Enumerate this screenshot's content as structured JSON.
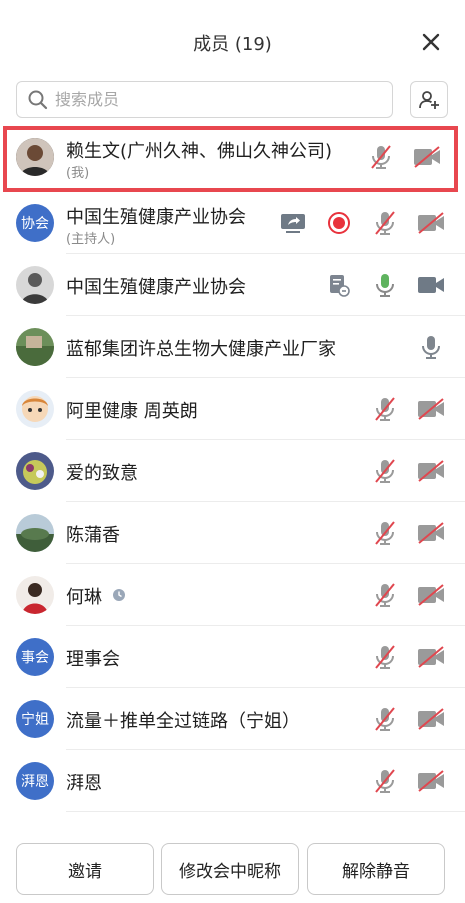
{
  "header": {
    "title": "成员 (19)"
  },
  "search": {
    "placeholder": "搜索成员"
  },
  "members": [
    {
      "name": "赖生文(广州久神、佛山久神公司)",
      "sub": "(我)",
      "avatar_text": "",
      "mic": "muted",
      "cam": "off"
    },
    {
      "name": "中国生殖健康产业协会",
      "sub": "(主持人)",
      "avatar_text": "协会",
      "mic": "muted",
      "cam": "off",
      "screen": true,
      "recording": true
    },
    {
      "name": "中国生殖健康产业协会",
      "sub": "",
      "avatar_text": "",
      "mic": "on",
      "cam": "on",
      "doc": true
    },
    {
      "name": "蓝郁集团许总生物大健康产业厂家",
      "sub": "",
      "avatar_text": "",
      "mic": "on-gray"
    },
    {
      "name": "阿里健康 周英朗",
      "sub": "",
      "avatar_text": "",
      "mic": "muted",
      "cam": "off"
    },
    {
      "name": "爱的致意",
      "sub": "",
      "avatar_text": "",
      "mic": "muted",
      "cam": "off"
    },
    {
      "name": "陈蒲香",
      "sub": "",
      "avatar_text": "",
      "mic": "muted",
      "cam": "off"
    },
    {
      "name": "何琳",
      "sub": "",
      "avatar_text": "",
      "mic": "muted",
      "cam": "off",
      "clock": true
    },
    {
      "name": "理事会",
      "sub": "",
      "avatar_text": "事会",
      "mic": "muted",
      "cam": "off"
    },
    {
      "name": "流量＋推单全过链路（宁姐）",
      "sub": "",
      "avatar_text": "宁姐",
      "mic": "muted",
      "cam": "off"
    },
    {
      "name": "湃恩",
      "sub": "",
      "avatar_text": "湃恩",
      "mic": "muted",
      "cam": "off"
    }
  ],
  "footer": {
    "invite_label": "邀请",
    "rename_label": "修改会中昵称",
    "unmute_label": "解除静音"
  },
  "colors": {
    "highlight": "#e8474f",
    "avatar_blue": "#3f6fc8",
    "red_slash": "#e0474f",
    "record_red": "#e8323c"
  }
}
